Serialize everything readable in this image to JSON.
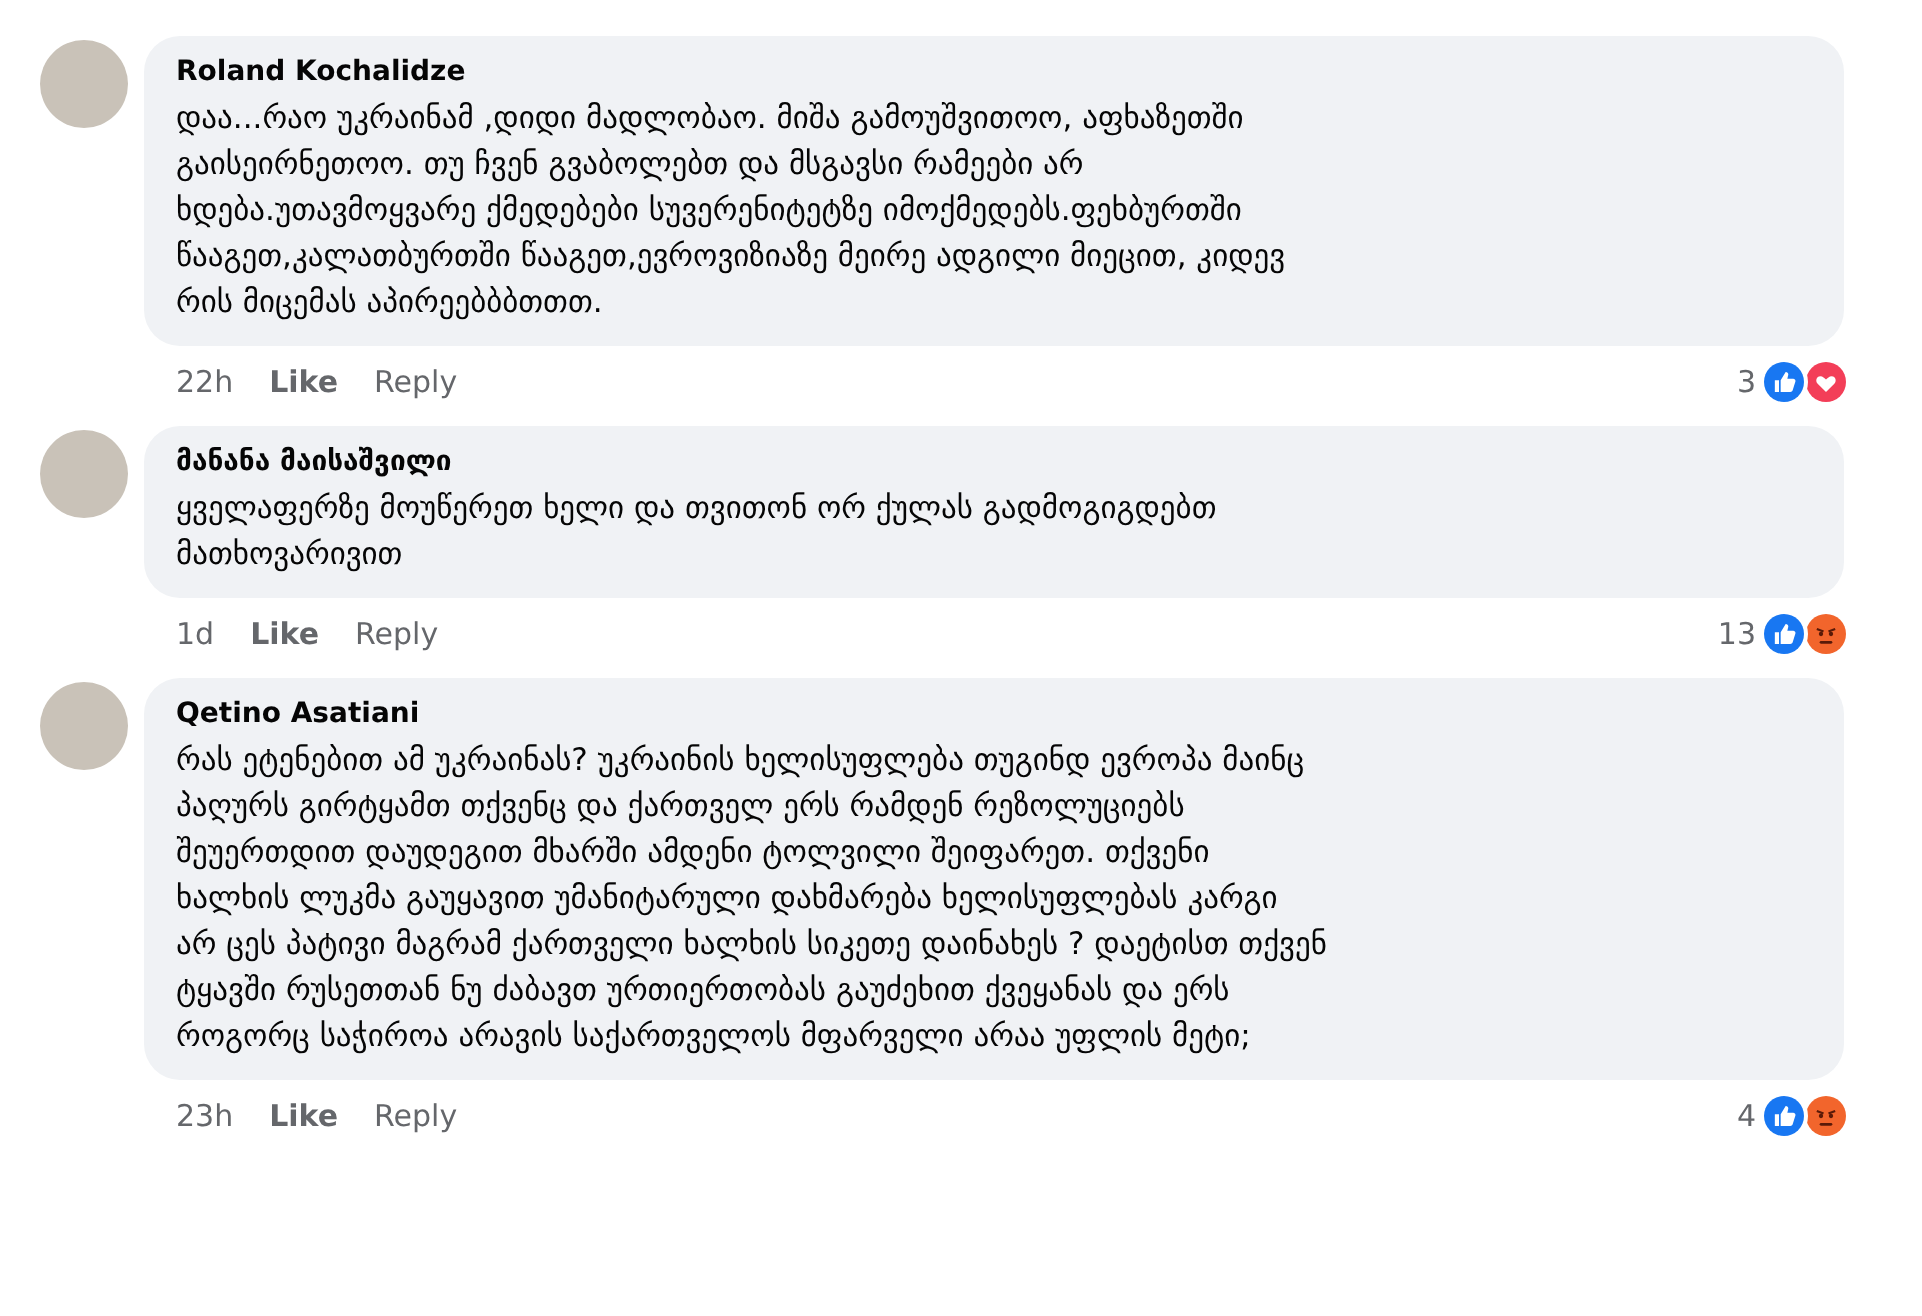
{
  "comments": [
    {
      "author": "Roland Kochalidze",
      "text": "დაა...რაო უკრაინამ ,დიდი მადლობაო. მიშა გამოუშვითოო, აფხაზეთში\nგაისეირნეთოო. თუ ჩვენ გვაბოლებთ და მსგავსი რამეები არ\nხდება.უთავმოყვარე ქმედებები სუვერენიტეტზე იმოქმედებს.ფეხბურთში\nწააგეთ,კალათბურთში წააგეთ,ევროვიზიაზე მეირე ადგილი მიეცით, კიდევ\nრის მიცემას აპირეებბბთთთ.",
      "time": "22h",
      "like": "Like",
      "reply": "Reply",
      "reaction_count": "3",
      "reactions": [
        {
          "kind": "like"
        },
        {
          "kind": "love"
        }
      ]
    },
    {
      "author": "მანანა მაისაშვილი",
      "text": "ყველაფერზე მოუწერეთ ხელი და თვითონ ორ ქულას გადმოგიგდებთ\nმათხოვარივით",
      "time": "1d",
      "like": "Like",
      "reply": "Reply",
      "reaction_count": "13",
      "reactions": [
        {
          "kind": "like"
        },
        {
          "kind": "angry"
        }
      ]
    },
    {
      "author": "Qetino Asatiani",
      "text": "რას ეტენებით ამ უკრაინას? უკრაინის ხელისუფლება თუგინდ ევროპა მაინც\nპაღურს გირტყამთ თქვენც და ქართველ ერს რამდენ რეზოლუციებს\nშეუერთდით დაუდეგით მხარში ამდენი ტოლვილი შეიფარეთ. თქვენი\nხალხის ლუკმა გაუყავით უმანიტარული დახმარება ხელისუფლებას კარგი\nარ ცეს პატივი მაგრამ ქართველი ხალხის სიკეთე დაინახეს ? დაეტისთ თქვენ\nტყავში რუსეთთან ნუ ძაბავთ ურთიერთობას გაუძეხით ქვეყანას და ერს\nროგორც საჭიროა არავის საქართველოს მფარველი არაა უფლის მეტი;",
      "time": "23h",
      "like": "Like",
      "reply": "Reply",
      "reaction_count": "4",
      "reactions": [
        {
          "kind": "like"
        },
        {
          "kind": "angry"
        }
      ]
    }
  ]
}
